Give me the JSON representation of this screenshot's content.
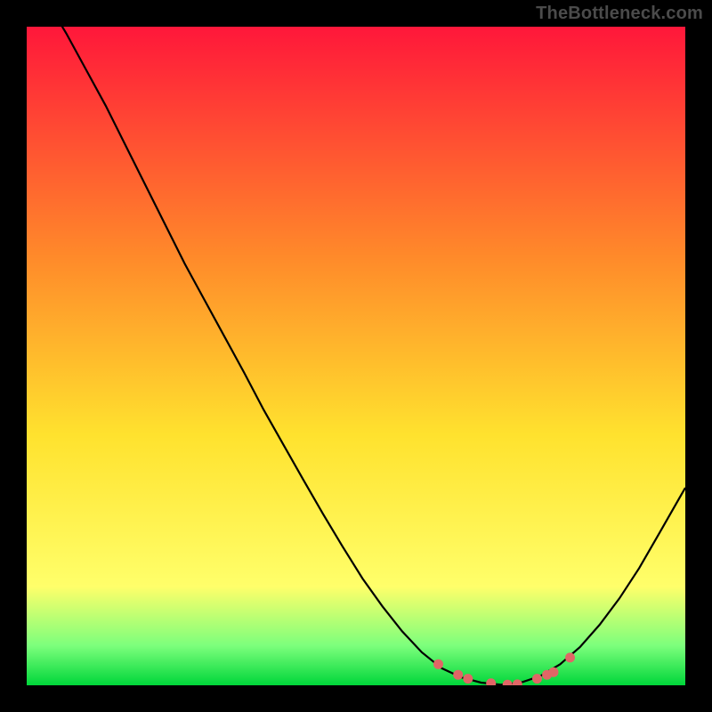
{
  "watermark": "TheBottleneck.com",
  "colors": {
    "curve_stroke": "#000000",
    "dot_fill": "#e06666",
    "grad_top": "#ff173a",
    "grad_mid_upper": "#ff8a2a",
    "grad_mid": "#ffe22e",
    "grad_yellow_soft": "#ffff6a",
    "grad_green_soft": "#7cff7c",
    "grad_green": "#00d63a"
  },
  "chart_data": {
    "type": "line",
    "title": "",
    "xlabel": "",
    "ylabel": "",
    "xlim": [
      0,
      100
    ],
    "ylim": [
      0,
      100
    ],
    "x": [
      0,
      3,
      6,
      9,
      12,
      15,
      18,
      21,
      24,
      27,
      30,
      33,
      36,
      39,
      42,
      45,
      48,
      51,
      54,
      57,
      60,
      63,
      66,
      69,
      72,
      75,
      78,
      81,
      84,
      87,
      90,
      93,
      96,
      100
    ],
    "values": [
      109,
      104,
      99,
      93.5,
      88,
      82,
      76,
      70,
      64,
      58.5,
      53,
      47.5,
      41.8,
      36.5,
      31.2,
      26,
      21,
      16.2,
      12,
      8.2,
      5,
      2.6,
      1.2,
      0.4,
      0.1,
      0.4,
      1.4,
      3.2,
      5.8,
      9.2,
      13.2,
      17.8,
      23,
      30
    ],
    "dots": [
      {
        "x": 62.5,
        "y": 3.2
      },
      {
        "x": 65.5,
        "y": 1.6
      },
      {
        "x": 67.0,
        "y": 1.0
      },
      {
        "x": 70.5,
        "y": 0.3
      },
      {
        "x": 73.0,
        "y": 0.1
      },
      {
        "x": 74.5,
        "y": 0.15
      },
      {
        "x": 77.5,
        "y": 1.0
      },
      {
        "x": 79.0,
        "y": 1.6
      },
      {
        "x": 80.0,
        "y": 2.0
      },
      {
        "x": 82.5,
        "y": 4.2
      }
    ]
  }
}
